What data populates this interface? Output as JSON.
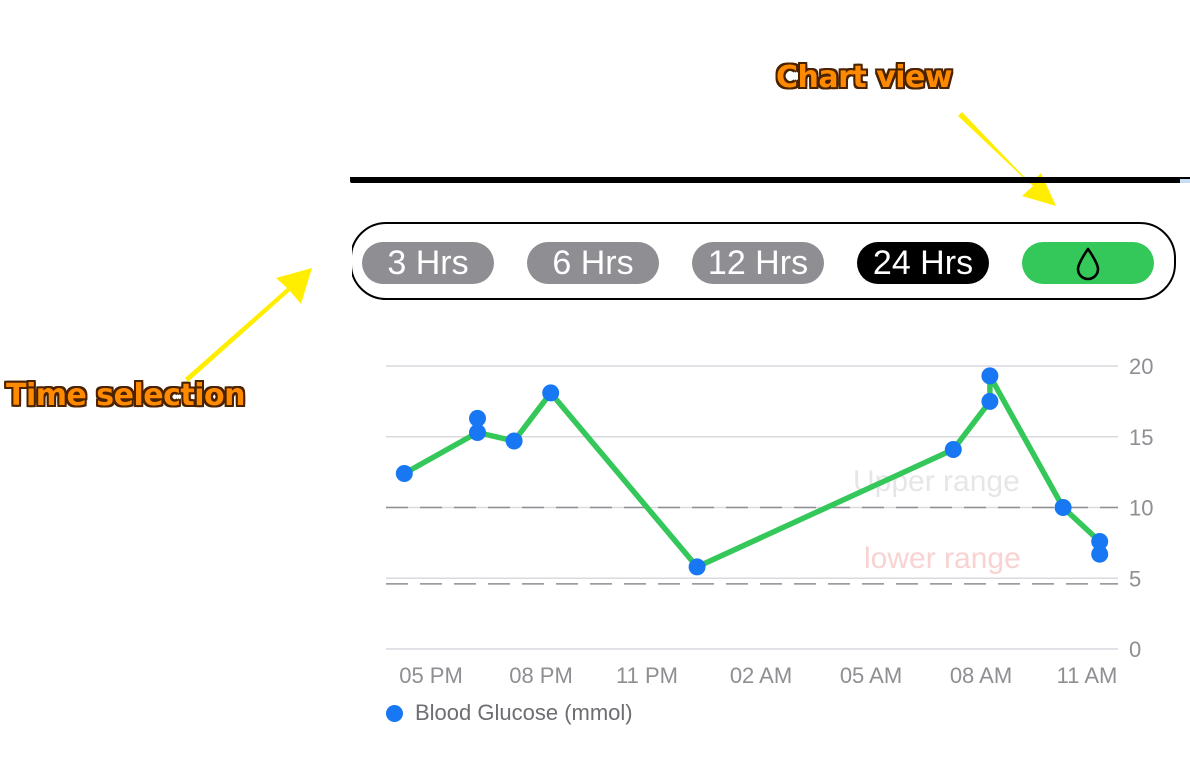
{
  "annotations": {
    "chart_view": "Chart view",
    "time_selection": "Time selection"
  },
  "time_selector": {
    "options": [
      "3 Hrs",
      "6 Hrs",
      "12 Hrs",
      "24 Hrs"
    ],
    "selected": "24 Hrs",
    "chart_view_icon": "drop-icon"
  },
  "colors": {
    "line": "#34c759",
    "point": "#1877f2",
    "pill": "#8e8e93",
    "pill_selected": "#000000",
    "chart_view_button": "#34c759",
    "upper_range_label": "#e6e6e8",
    "lower_range_label": "#f9d2d2",
    "annotation_text": "#ff8a00",
    "arrow": "#ffee00"
  },
  "chart_data": {
    "type": "line",
    "series": [
      {
        "name": "Blood Glucose (mmol)",
        "points": [
          {
            "time": "04:30 PM",
            "value": 12.4
          },
          {
            "time": "06:30 PM",
            "value": 16.3
          },
          {
            "time": "06:30 PM",
            "value": 15.3
          },
          {
            "time": "07:30 PM",
            "value": 14.7
          },
          {
            "time": "08:30 PM",
            "value": 18.1
          },
          {
            "time": "12:30 AM",
            "value": 5.8
          },
          {
            "time": "07:30 AM",
            "value": 14.1
          },
          {
            "time": "08:30 AM",
            "value": 17.5
          },
          {
            "time": "08:30 AM",
            "value": 19.3
          },
          {
            "time": "10:30 AM",
            "value": 10.0
          },
          {
            "time": "11:30 AM",
            "value": 7.6
          },
          {
            "time": "11:30 AM",
            "value": 6.7
          }
        ],
        "line_path": [
          {
            "time": "04:30 PM",
            "value": 12.4
          },
          {
            "time": "06:30 PM",
            "value": 15.3
          },
          {
            "time": "07:30 PM",
            "value": 14.7
          },
          {
            "time": "08:30 PM",
            "value": 18.1
          },
          {
            "time": "12:30 AM",
            "value": 5.8
          },
          {
            "time": "07:30 AM",
            "value": 14.1
          },
          {
            "time": "08:30 AM",
            "value": 17.5
          },
          {
            "time": "08:30 AM",
            "value": 19.3
          },
          {
            "time": "10:30 AM",
            "value": 10.0
          },
          {
            "time": "11:30 AM",
            "value": 7.6
          },
          {
            "time": "11:30 AM",
            "value": 6.7
          }
        ]
      }
    ],
    "x_tick_labels": [
      "05 PM",
      "08 PM",
      "11 PM",
      "02 AM",
      "05 AM",
      "08 AM",
      "11 AM"
    ],
    "y_tick_labels": [
      "0",
      "5",
      "10",
      "15",
      "20"
    ],
    "ylim": [
      0,
      20
    ],
    "grid": true,
    "reference_lines": [
      {
        "value": 10,
        "label": "Upper range"
      },
      {
        "value": 4.6,
        "label": "lower range"
      }
    ],
    "legend": "bottom-left"
  }
}
